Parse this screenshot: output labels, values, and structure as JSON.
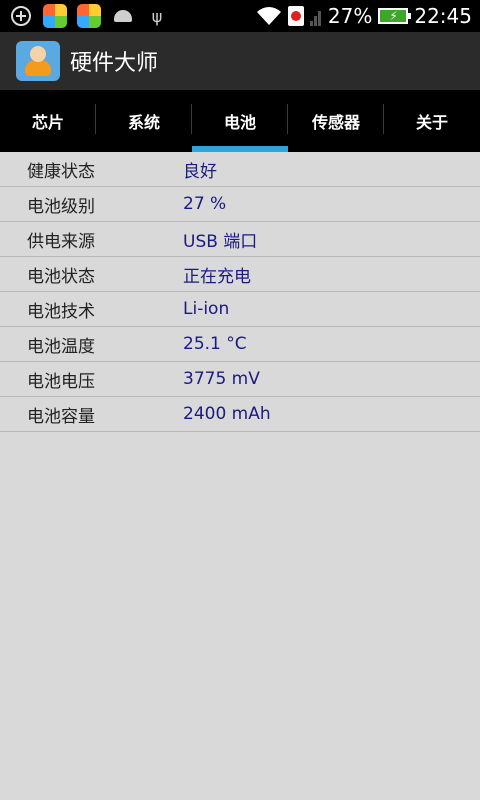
{
  "status_bar": {
    "battery_percent": "27%",
    "time": "22:45",
    "icons": [
      "add-circle-icon",
      "app-notification-icon",
      "app-notification-icon",
      "android-debug-icon",
      "usb-icon",
      "wifi-icon",
      "sim-alert-icon",
      "signal-icon",
      "battery-charging-icon"
    ]
  },
  "app": {
    "title": "硬件大师",
    "icon": "monk-app-icon"
  },
  "tabs": [
    {
      "label": "芯片"
    },
    {
      "label": "系统"
    },
    {
      "label": "电池"
    },
    {
      "label": "传感器"
    },
    {
      "label": "关于"
    }
  ],
  "active_tab": "电池",
  "accent_color": "#33a4d6",
  "battery_info": [
    {
      "label": "健康状态",
      "value": "良好"
    },
    {
      "label": "电池级别",
      "value": "27 %"
    },
    {
      "label": "供电来源",
      "value": "USB 端口"
    },
    {
      "label": "电池状态",
      "value": "正在充电"
    },
    {
      "label": "电池技术",
      "value": "Li-ion"
    },
    {
      "label": "电池温度",
      "value": "25.1 °C"
    },
    {
      "label": "电池电压",
      "value": "3775 mV"
    },
    {
      "label": "电池容量",
      "value": "2400 mAh"
    }
  ]
}
